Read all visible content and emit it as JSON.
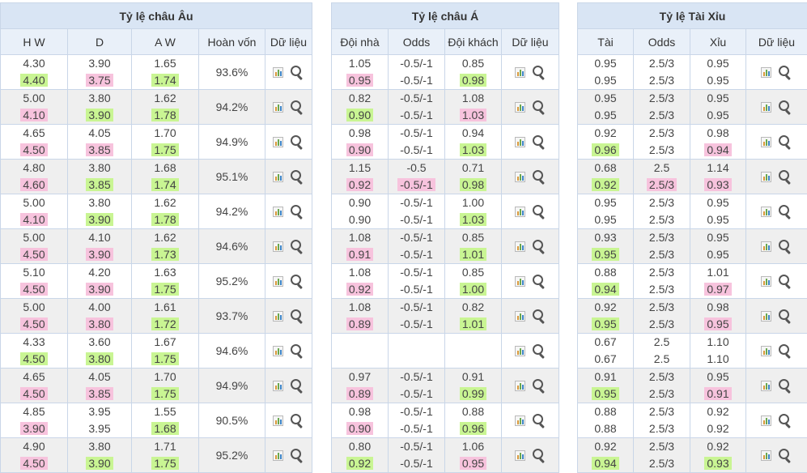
{
  "euro": {
    "title": "Tỷ lệ châu Âu",
    "headers": [
      "H W",
      "D",
      "A W",
      "Hoàn vốn",
      "Dữ liệu"
    ],
    "rows": [
      {
        "hw": [
          "4.30",
          "4.40"
        ],
        "d": [
          "3.90",
          "3.75"
        ],
        "aw": [
          "1.65",
          "1.74"
        ],
        "ret": "93.6%"
      },
      {
        "hw": [
          "5.00",
          "4.10"
        ],
        "d": [
          "3.80",
          "3.90"
        ],
        "aw": [
          "1.62",
          "1.78"
        ],
        "ret": "94.2%"
      },
      {
        "hw": [
          "4.65",
          "4.50"
        ],
        "d": [
          "4.05",
          "3.85"
        ],
        "aw": [
          "1.70",
          "1.75"
        ],
        "ret": "94.9%"
      },
      {
        "hw": [
          "4.80",
          "4.60"
        ],
        "d": [
          "3.80",
          "3.85"
        ],
        "aw": [
          "1.68",
          "1.74"
        ],
        "ret": "95.1%"
      },
      {
        "hw": [
          "5.00",
          "4.10"
        ],
        "d": [
          "3.80",
          "3.90"
        ],
        "aw": [
          "1.62",
          "1.78"
        ],
        "ret": "94.2%"
      },
      {
        "hw": [
          "5.00",
          "4.50"
        ],
        "d": [
          "4.10",
          "3.90"
        ],
        "aw": [
          "1.62",
          "1.73"
        ],
        "ret": "94.6%"
      },
      {
        "hw": [
          "5.10",
          "4.50"
        ],
        "d": [
          "4.20",
          "3.90"
        ],
        "aw": [
          "1.63",
          "1.75"
        ],
        "ret": "95.2%"
      },
      {
        "hw": [
          "5.00",
          "4.50"
        ],
        "d": [
          "4.00",
          "3.80"
        ],
        "aw": [
          "1.61",
          "1.72"
        ],
        "ret": "93.7%"
      },
      {
        "hw": [
          "4.33",
          "4.50"
        ],
        "d": [
          "3.60",
          "3.80"
        ],
        "aw": [
          "1.67",
          "1.75"
        ],
        "ret": "94.6%"
      },
      {
        "hw": [
          "4.65",
          "4.50"
        ],
        "d": [
          "4.05",
          "3.85"
        ],
        "aw": [
          "1.70",
          "1.75"
        ],
        "ret": "94.9%"
      },
      {
        "hw": [
          "4.85",
          "3.90"
        ],
        "d": [
          "3.95",
          "3.95"
        ],
        "aw": [
          "1.55",
          "1.68"
        ],
        "ret": "90.5%"
      },
      {
        "hw": [
          "4.90",
          "4.50"
        ],
        "d": [
          "3.80",
          "3.90"
        ],
        "aw": [
          "1.71",
          "1.75"
        ],
        "ret": "95.2%"
      }
    ]
  },
  "asia": {
    "title": "Tỷ lệ châu Á",
    "headers": [
      "Đội nhà",
      "Odds",
      "Đội khách",
      "Dữ liệu"
    ],
    "rows": [
      {
        "home": [
          "1.05",
          "0.95"
        ],
        "odds": [
          "-0.5/-1",
          "-0.5/-1"
        ],
        "away": [
          "0.85",
          "0.98"
        ]
      },
      {
        "home": [
          "0.82",
          "0.90"
        ],
        "odds": [
          "-0.5/-1",
          "-0.5/-1"
        ],
        "away": [
          "1.08",
          "1.03"
        ]
      },
      {
        "home": [
          "0.98",
          "0.90"
        ],
        "odds": [
          "-0.5/-1",
          "-0.5/-1"
        ],
        "away": [
          "0.94",
          "1.03"
        ]
      },
      {
        "home": [
          "1.15",
          "0.92"
        ],
        "odds": [
          "-0.5",
          "-0.5/-1"
        ],
        "away": [
          "0.71",
          "0.98"
        ]
      },
      {
        "home": [
          "0.90",
          "0.90"
        ],
        "odds": [
          "-0.5/-1",
          "-0.5/-1"
        ],
        "away": [
          "1.00",
          "1.03"
        ]
      },
      {
        "home": [
          "1.08",
          "0.91"
        ],
        "odds": [
          "-0.5/-1",
          "-0.5/-1"
        ],
        "away": [
          "0.85",
          "1.01"
        ]
      },
      {
        "home": [
          "1.08",
          "0.92"
        ],
        "odds": [
          "-0.5/-1",
          "-0.5/-1"
        ],
        "away": [
          "0.85",
          "1.00"
        ]
      },
      {
        "home": [
          "1.08",
          "0.89"
        ],
        "odds": [
          "-0.5/-1",
          "-0.5/-1"
        ],
        "away": [
          "0.82",
          "1.01"
        ]
      },
      {
        "home": [
          "",
          ""
        ],
        "odds": [
          "",
          ""
        ],
        "away": [
          "",
          ""
        ]
      },
      {
        "home": [
          "0.97",
          "0.89"
        ],
        "odds": [
          "-0.5/-1",
          "-0.5/-1"
        ],
        "away": [
          "0.91",
          "0.99"
        ]
      },
      {
        "home": [
          "0.98",
          "0.90"
        ],
        "odds": [
          "-0.5/-1",
          "-0.5/-1"
        ],
        "away": [
          "0.88",
          "0.96"
        ]
      },
      {
        "home": [
          "0.80",
          "0.92"
        ],
        "odds": [
          "-0.5/-1",
          "-0.5/-1"
        ],
        "away": [
          "1.06",
          "0.95"
        ]
      }
    ]
  },
  "ou": {
    "title": "Tỷ lệ Tài Xỉu",
    "headers": [
      "Tài",
      "Odds",
      "Xỉu",
      "Dữ liệu"
    ],
    "rows": [
      {
        "over": [
          "0.95",
          "0.95"
        ],
        "odds": [
          "2.5/3",
          "2.5/3"
        ],
        "under": [
          "0.95",
          "0.95"
        ]
      },
      {
        "over": [
          "0.95",
          "0.95"
        ],
        "odds": [
          "2.5/3",
          "2.5/3"
        ],
        "under": [
          "0.95",
          "0.95"
        ]
      },
      {
        "over": [
          "0.92",
          "0.96"
        ],
        "odds": [
          "2.5/3",
          "2.5/3"
        ],
        "under": [
          "0.98",
          "0.94"
        ]
      },
      {
        "over": [
          "0.68",
          "0.92"
        ],
        "odds": [
          "2.5",
          "2.5/3"
        ],
        "under": [
          "1.14",
          "0.93"
        ]
      },
      {
        "over": [
          "0.95",
          "0.95"
        ],
        "odds": [
          "2.5/3",
          "2.5/3"
        ],
        "under": [
          "0.95",
          "0.95"
        ]
      },
      {
        "over": [
          "0.93",
          "0.95"
        ],
        "odds": [
          "2.5/3",
          "2.5/3"
        ],
        "under": [
          "0.95",
          "0.95"
        ]
      },
      {
        "over": [
          "0.88",
          "0.94"
        ],
        "odds": [
          "2.5/3",
          "2.5/3"
        ],
        "under": [
          "1.01",
          "0.97"
        ]
      },
      {
        "over": [
          "0.92",
          "0.95"
        ],
        "odds": [
          "2.5/3",
          "2.5/3"
        ],
        "under": [
          "0.98",
          "0.95"
        ]
      },
      {
        "over": [
          "0.67",
          "0.67"
        ],
        "odds": [
          "2.5",
          "2.5"
        ],
        "under": [
          "1.10",
          "1.10"
        ]
      },
      {
        "over": [
          "0.91",
          "0.95"
        ],
        "odds": [
          "2.5/3",
          "2.5/3"
        ],
        "under": [
          "0.95",
          "0.91"
        ]
      },
      {
        "over": [
          "0.88",
          "0.88"
        ],
        "odds": [
          "2.5/3",
          "2.5/3"
        ],
        "under": [
          "0.92",
          "0.92"
        ]
      },
      {
        "over": [
          "0.92",
          "0.94"
        ],
        "odds": [
          "2.5/3",
          "2.5/3"
        ],
        "under": [
          "0.92",
          "0.93"
        ]
      }
    ]
  },
  "colors": {
    "up": "#c9f593",
    "down": "#f7c3dd",
    "header": "#d9e5f4",
    "alt_row": "#efefef"
  },
  "icons": [
    "bar-chart-icon",
    "search-icon"
  ]
}
